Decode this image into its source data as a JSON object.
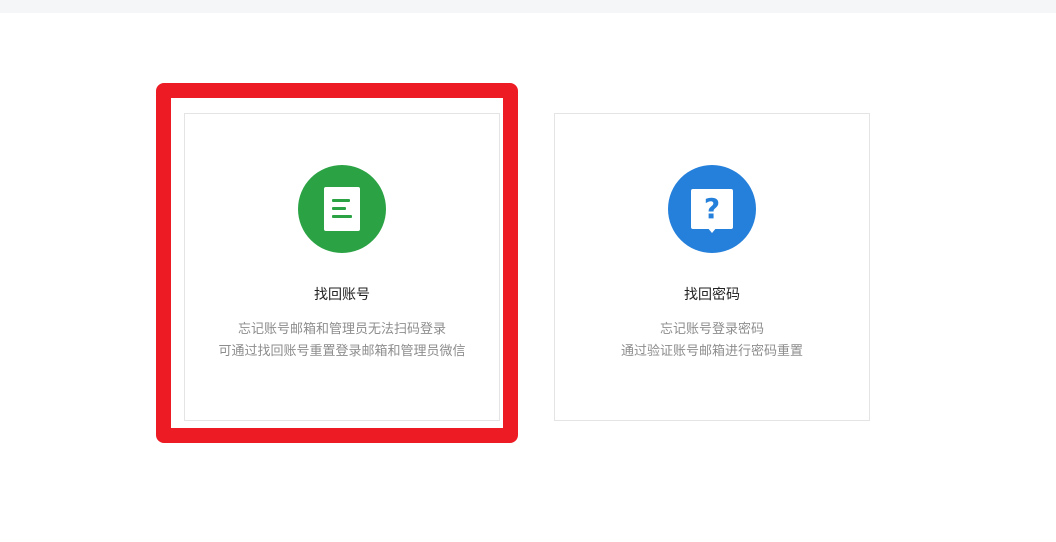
{
  "cards": [
    {
      "title": "找回账号",
      "desc_line1": "忘记账号邮箱和管理员无法扫码登录",
      "desc_line2": "可通过找回账号重置登录邮箱和管理员微信",
      "icon": "document-icon",
      "icon_color": "#2ba345"
    },
    {
      "title": "找回密码",
      "desc_line1": "忘记账号登录密码",
      "desc_line2": "通过验证账号邮箱进行密码重置",
      "icon": "help-question-icon",
      "icon_color": "#2580db"
    }
  ],
  "highlight_color": "#ed1c24"
}
